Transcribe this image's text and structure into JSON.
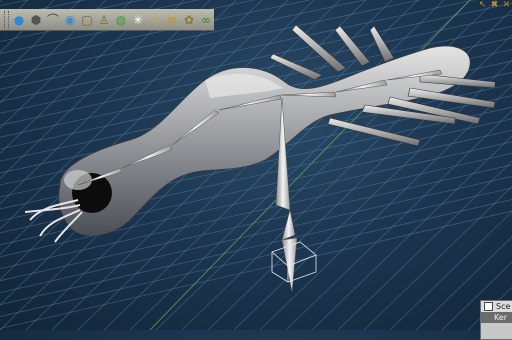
{
  "toolbar": {
    "tools": [
      {
        "name": "globe-icon",
        "glyph": "●",
        "color": "#2a8ad8"
      },
      {
        "name": "mesh-icon",
        "glyph": "⬢",
        "color": "#555555"
      },
      {
        "name": "bend-icon",
        "glyph": "⌒",
        "color": "#444444"
      },
      {
        "name": "sphere-icon",
        "glyph": "◉",
        "color": "#3a8ac8"
      },
      {
        "name": "cube-icon",
        "glyph": "▢",
        "color": "#8a5a2a"
      },
      {
        "name": "bone-tool-icon",
        "glyph": "♙",
        "color": "#7a6a2a"
      },
      {
        "name": "color-icon",
        "glyph": "◍",
        "color": "#3a9a3a"
      },
      {
        "name": "spark-icon",
        "glyph": "✳",
        "color": "#ffffff"
      },
      {
        "name": "disc-icon",
        "glyph": "⬭",
        "color": "#d8a020"
      },
      {
        "name": "layers-icon",
        "glyph": "≋",
        "color": "#c89020"
      },
      {
        "name": "flower-icon",
        "glyph": "✿",
        "color": "#8a7a30"
      },
      {
        "name": "chain-icon",
        "glyph": "∞",
        "color": "#2a8a2a"
      }
    ]
  },
  "window_controls": [
    "↖",
    "✖",
    "✕"
  ],
  "scene_panel": {
    "rows": [
      "Sce",
      "Ker"
    ]
  }
}
